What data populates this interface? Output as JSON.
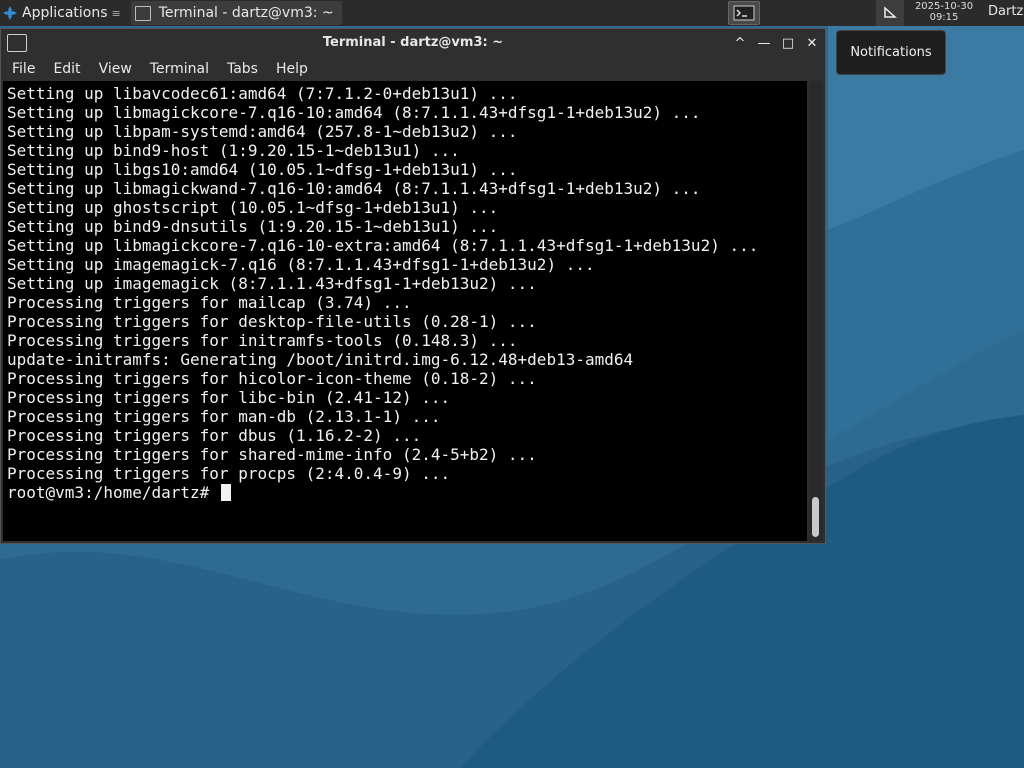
{
  "panel": {
    "applications_label": "Applications",
    "task_label": "Terminal - dartz@vm3: ~",
    "date": "2025-10-30",
    "time": "09:15",
    "user": "Dartz"
  },
  "notification": {
    "label": "Notifications"
  },
  "window": {
    "title": "Terminal - dartz@vm3: ~",
    "controls": {
      "up": "^",
      "minimize": "—",
      "maximize": "□",
      "close": "✕"
    }
  },
  "menu": [
    "File",
    "Edit",
    "View",
    "Terminal",
    "Tabs",
    "Help"
  ],
  "terminal": {
    "lines": [
      "Setting up libavcodec61:amd64 (7:7.1.2-0+deb13u1) ...",
      "Setting up libmagickcore-7.q16-10:amd64 (8:7.1.1.43+dfsg1-1+deb13u2) ...",
      "Setting up libpam-systemd:amd64 (257.8-1~deb13u2) ...",
      "Setting up bind9-host (1:9.20.15-1~deb13u1) ...",
      "Setting up libgs10:amd64 (10.05.1~dfsg-1+deb13u1) ...",
      "Setting up libmagickwand-7.q16-10:amd64 (8:7.1.1.43+dfsg1-1+deb13u2) ...",
      "Setting up ghostscript (10.05.1~dfsg-1+deb13u1) ...",
      "Setting up bind9-dnsutils (1:9.20.15-1~deb13u1) ...",
      "Setting up libmagickcore-7.q16-10-extra:amd64 (8:7.1.1.43+dfsg1-1+deb13u2) ...",
      "Setting up imagemagick-7.q16 (8:7.1.1.43+dfsg1-1+deb13u2) ...",
      "Setting up imagemagick (8:7.1.1.43+dfsg1-1+deb13u2) ...",
      "Processing triggers for mailcap (3.74) ...",
      "Processing triggers for desktop-file-utils (0.28-1) ...",
      "Processing triggers for initramfs-tools (0.148.3) ...",
      "update-initramfs: Generating /boot/initrd.img-6.12.48+deb13-amd64",
      "Processing triggers for hicolor-icon-theme (0.18-2) ...",
      "Processing triggers for libc-bin (2.41-12) ...",
      "Processing triggers for man-db (2.13.1-1) ...",
      "Processing triggers for dbus (1.16.2-2) ...",
      "Processing triggers for shared-mime-info (2.4-5+b2) ...",
      "Processing triggers for procps (2:4.0.4-9) ..."
    ],
    "prompt": "root@vm3:/home/dartz# "
  }
}
